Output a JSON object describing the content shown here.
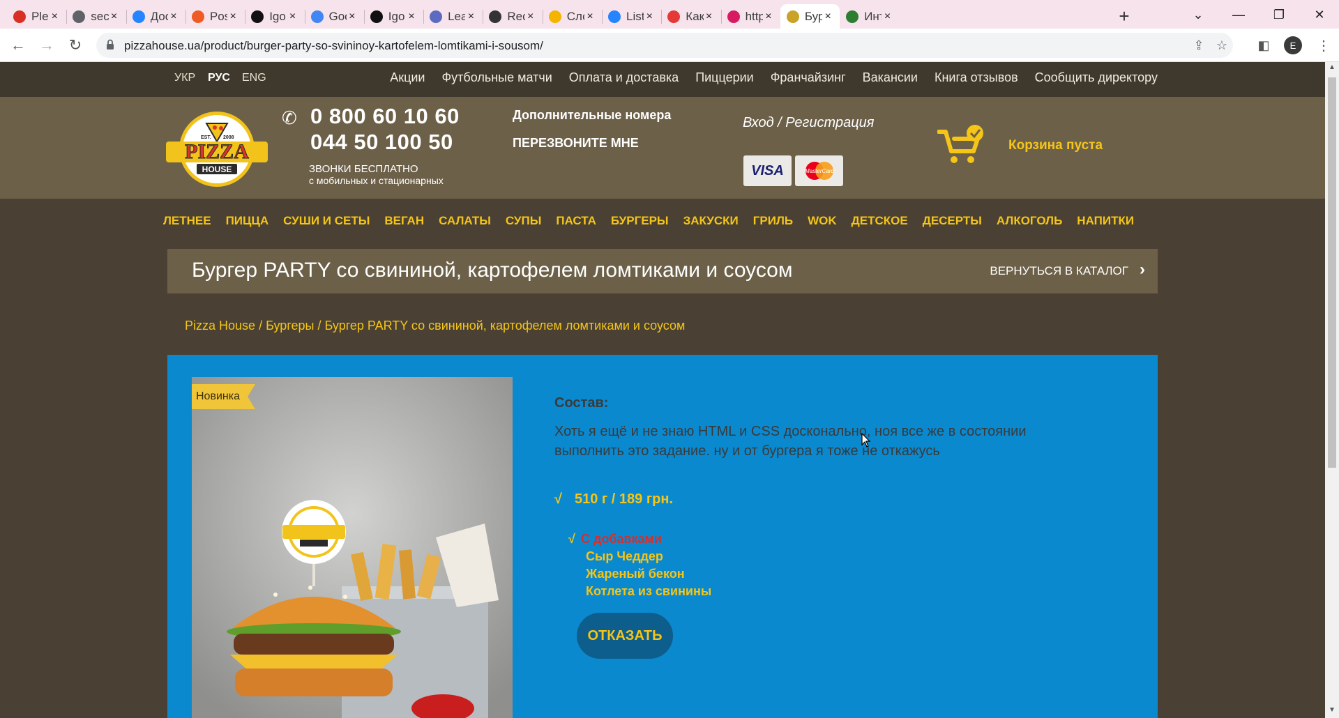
{
  "browser": {
    "tabs": [
      {
        "title": "Plea",
        "icon": "gmail-icon",
        "color": "#d93025"
      },
      {
        "title": "sec",
        "icon": "globe-icon",
        "color": "#5f6368"
      },
      {
        "title": "Доc",
        "icon": "jira-icon",
        "color": "#2684ff"
      },
      {
        "title": "Pos",
        "icon": "postman-icon",
        "color": "#ef5b25"
      },
      {
        "title": "Igo",
        "icon": "github-icon",
        "color": "#111111"
      },
      {
        "title": "Goo",
        "icon": "google-translate-icon",
        "color": "#4285f4"
      },
      {
        "title": "Igo",
        "icon": "github-icon",
        "color": "#111111"
      },
      {
        "title": "Lea",
        "icon": "learn-icon",
        "color": "#5c6bc0"
      },
      {
        "title": "Rec",
        "icon": "record-icon",
        "color": "#333333"
      },
      {
        "title": "Сло",
        "icon": "bulb-icon",
        "color": "#f4b400"
      },
      {
        "title": "List",
        "icon": "jira-icon",
        "color": "#2684ff"
      },
      {
        "title": "Как",
        "icon": "xo-icon",
        "color": "#e53935"
      },
      {
        "title": "http",
        "icon": "web-icon",
        "color": "#d81b60"
      },
      {
        "title": "Бур",
        "icon": "pizzahouse-icon",
        "color": "#c9a227"
      },
      {
        "title": "Инт",
        "icon": "leaf-icon",
        "color": "#2e7d32"
      }
    ],
    "active_tab": 13,
    "url": "pizzahouse.ua/product/burger-party-so-svininoy-kartofelem-lomtikami-i-sousom/",
    "profile_initial": "E"
  },
  "site": {
    "languages": [
      "УКР",
      "РУС",
      "ENG"
    ],
    "current_language": "РУС",
    "top_menu": [
      "Акции",
      "Футбольные матчи",
      "Оплата и доставка",
      "Пиццерии",
      "Франчайзинг",
      "Вакансии",
      "Книга отзывов",
      "Сообщить директору"
    ],
    "logo": {
      "top": "EST.",
      "year": "2008",
      "main": "PIZZA",
      "sub": "HOUSE"
    },
    "phones": [
      "0 800 60 10 60",
      "044 50 100 50"
    ],
    "free_calls": "ЗВОНКИ БЕСПЛАТНО",
    "free_calls_sub": "с мобильных и стационарных",
    "extra_numbers": "Дополнительные номера",
    "callback": "ПЕРЕЗВОНИТЕ МНЕ",
    "login": "Вход / Регистрация",
    "payment": {
      "visa": "VISA",
      "mastercard": "MasterCard"
    },
    "cart_label": "Корзина пуста",
    "categories": [
      "ЛЕТНЕЕ",
      "ПИЦЦА",
      "СУШИ И СЕТЫ",
      "ВЕГАН",
      "САЛАТЫ",
      "СУПЫ",
      "ПАСТА",
      "БУРГЕРЫ",
      "ЗАКУСКИ",
      "ГРИЛЬ",
      "WOK",
      "ДЕТСКОЕ",
      "ДЕСЕРТЫ",
      "АЛКОГОЛЬ",
      "НАПИТКИ"
    ],
    "accent": "#f5c518"
  },
  "product": {
    "title": "Бургер PARTY со свининой, картофелем ломтиками и соусом",
    "back_label": "ВЕРНУТЬСЯ В КАТАЛОГ",
    "breadcrumbs": [
      "Pizza House",
      "Бургеры",
      "Бургер PARTY со свининой, картофелем ломтиками и соусом"
    ],
    "badge": "Новинка",
    "composition_label": "Состав:",
    "composition_text": "Хоть я ещё и не знаю HTML и CSS досконально, ноя все же в состоянии выполнить это задание. ну и от бургера я тоже не откажусь",
    "weight_price": "510 г / 189 грн.",
    "check": "√",
    "addons_label": "С добавками",
    "addons": [
      "Сыр Чеддер",
      "Жареный бекон",
      "Котлета из свинины"
    ],
    "refuse_label": "ОТКАЗАТЬ",
    "bg_color": "#0b89cf"
  }
}
